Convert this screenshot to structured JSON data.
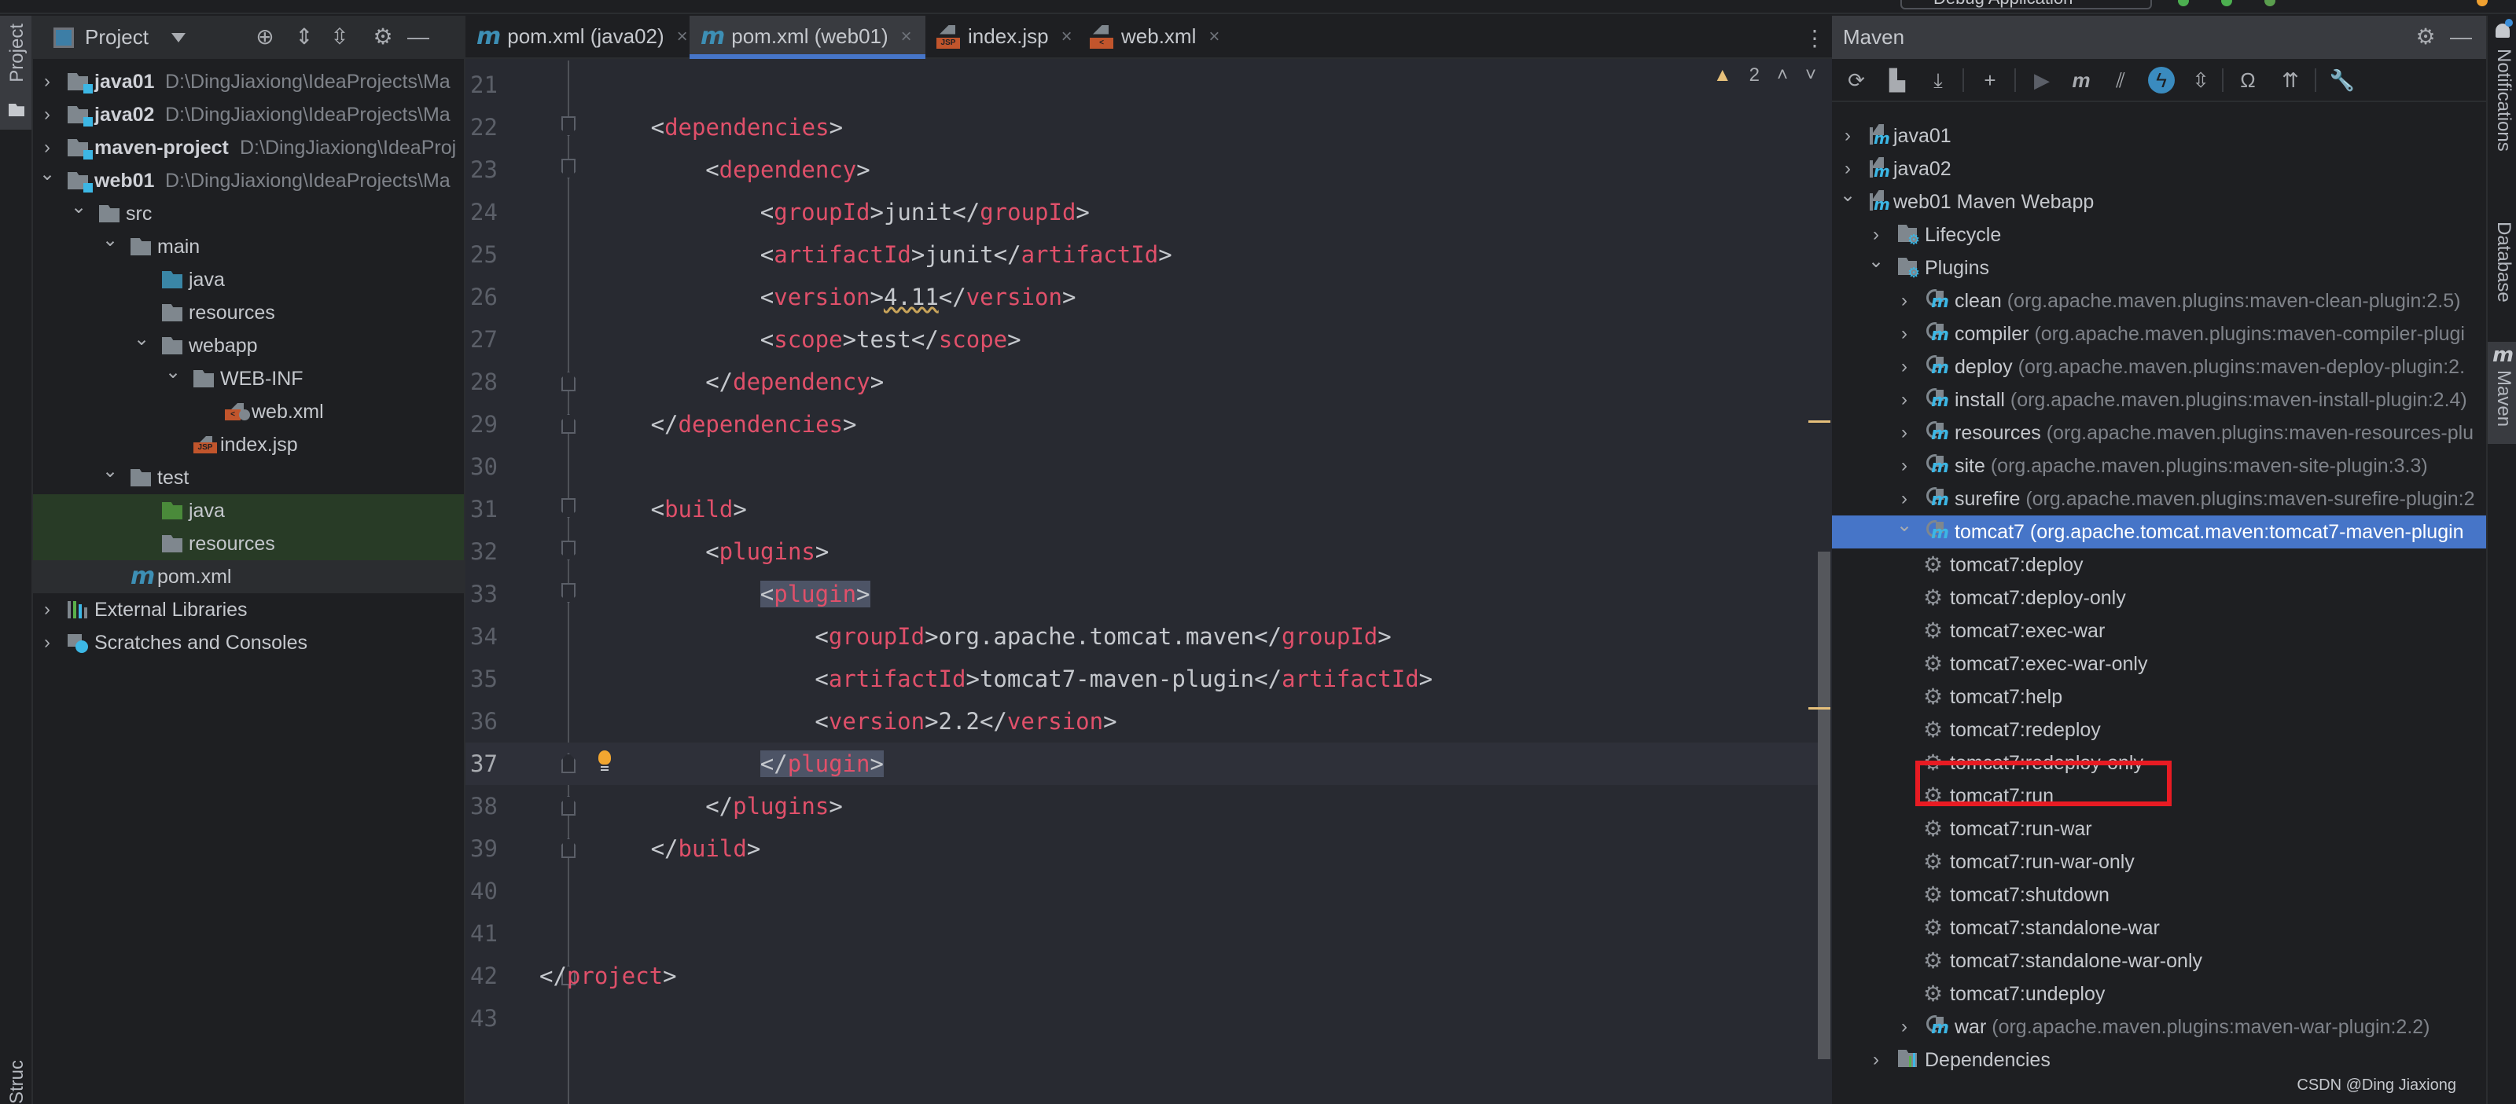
{
  "topbar": {
    "run_config": "Debug Application"
  },
  "left_stripe": {
    "project_tab": "Project",
    "structure_tab": "Structure"
  },
  "project_panel": {
    "title": "Project",
    "toolbar": [
      "locate-icon",
      "expand-all-icon",
      "collapse-all-icon",
      "gear-icon",
      "minimize-icon"
    ],
    "tree": [
      {
        "label": "java01",
        "path": "D:\\DingJiaxiong\\IdeaProjects\\Ma",
        "depth": 0,
        "expanded": false,
        "icon": "module-folder",
        "bold": true
      },
      {
        "label": "java02",
        "path": "D:\\DingJiaxiong\\IdeaProjects\\Ma",
        "depth": 0,
        "expanded": false,
        "icon": "module-folder",
        "bold": true
      },
      {
        "label": "maven-project",
        "path": "D:\\DingJiaxiong\\IdeaProj",
        "depth": 0,
        "expanded": false,
        "icon": "module-folder",
        "bold": true
      },
      {
        "label": "web01",
        "path": "D:\\DingJiaxiong\\IdeaProjects\\Ma",
        "depth": 0,
        "expanded": true,
        "icon": "module-folder",
        "bold": true
      },
      {
        "label": "src",
        "depth": 1,
        "expanded": true,
        "icon": "folder"
      },
      {
        "label": "main",
        "depth": 2,
        "expanded": true,
        "icon": "folder"
      },
      {
        "label": "java",
        "depth": 3,
        "icon": "source-folder"
      },
      {
        "label": "resources",
        "depth": 3,
        "icon": "resources-folder"
      },
      {
        "label": "webapp",
        "depth": 3,
        "expanded": true,
        "icon": "web-folder"
      },
      {
        "label": "WEB-INF",
        "depth": 4,
        "expanded": true,
        "icon": "folder"
      },
      {
        "label": "web.xml",
        "depth": 5,
        "icon": "web-xml-file"
      },
      {
        "label": "index.jsp",
        "depth": 4,
        "icon": "jsp-file"
      },
      {
        "label": "test",
        "depth": 2,
        "expanded": true,
        "icon": "folder"
      },
      {
        "label": "java",
        "depth": 3,
        "icon": "test-source-folder"
      },
      {
        "label": "resources",
        "depth": 3,
        "icon": "test-resources-folder"
      },
      {
        "label": "pom.xml",
        "depth": 2,
        "icon": "maven-file"
      },
      {
        "label": "External Libraries",
        "depth": 0,
        "expanded": false,
        "icon": "libraries"
      },
      {
        "label": "Scratches and Consoles",
        "depth": 0,
        "expanded": false,
        "icon": "scratches"
      }
    ]
  },
  "editor": {
    "tabs": [
      {
        "label": "pom.xml (java02)",
        "icon": "maven-file",
        "active": false
      },
      {
        "label": "pom.xml (web01)",
        "icon": "maven-file",
        "active": true
      },
      {
        "label": "index.jsp",
        "icon": "jsp-file",
        "active": false
      },
      {
        "label": "web.xml",
        "icon": "web-xml-file",
        "active": false
      }
    ],
    "inspection": {
      "warnings": "2"
    },
    "current_line": 37,
    "lines": [
      {
        "n": "21",
        "indent": 0,
        "parts": []
      },
      {
        "n": "22",
        "indent": 1,
        "parts": [
          [
            "b",
            "<"
          ],
          [
            "t",
            "dependencies"
          ],
          [
            "b",
            ">"
          ]
        ],
        "fold": "open"
      },
      {
        "n": "23",
        "indent": 2,
        "parts": [
          [
            "b",
            "<"
          ],
          [
            "t",
            "dependency"
          ],
          [
            "b",
            ">"
          ]
        ],
        "fold": "open"
      },
      {
        "n": "24",
        "indent": 3,
        "parts": [
          [
            "b",
            "<"
          ],
          [
            "t",
            "groupId"
          ],
          [
            "b",
            ">"
          ],
          [
            "x",
            "junit"
          ],
          [
            "b",
            "</"
          ],
          [
            "t",
            "groupId"
          ],
          [
            "b",
            ">"
          ]
        ]
      },
      {
        "n": "25",
        "indent": 3,
        "parts": [
          [
            "b",
            "<"
          ],
          [
            "t",
            "artifactId"
          ],
          [
            "b",
            ">"
          ],
          [
            "x",
            "junit"
          ],
          [
            "b",
            "</"
          ],
          [
            "t",
            "artifactId"
          ],
          [
            "b",
            ">"
          ]
        ]
      },
      {
        "n": "26",
        "indent": 3,
        "parts": [
          [
            "b",
            "<"
          ],
          [
            "t",
            "version"
          ],
          [
            "b",
            ">"
          ],
          [
            "w",
            "4.11"
          ],
          [
            "b",
            "</"
          ],
          [
            "t",
            "version"
          ],
          [
            "b",
            ">"
          ]
        ]
      },
      {
        "n": "27",
        "indent": 3,
        "parts": [
          [
            "b",
            "<"
          ],
          [
            "t",
            "scope"
          ],
          [
            "b",
            ">"
          ],
          [
            "x",
            "test"
          ],
          [
            "b",
            "</"
          ],
          [
            "t",
            "scope"
          ],
          [
            "b",
            ">"
          ]
        ]
      },
      {
        "n": "28",
        "indent": 2,
        "parts": [
          [
            "b",
            "</"
          ],
          [
            "t",
            "dependency"
          ],
          [
            "b",
            ">"
          ]
        ],
        "fold": "close"
      },
      {
        "n": "29",
        "indent": 1,
        "parts": [
          [
            "b",
            "</"
          ],
          [
            "t",
            "dependencies"
          ],
          [
            "b",
            ">"
          ]
        ],
        "fold": "close"
      },
      {
        "n": "30",
        "indent": 0,
        "parts": []
      },
      {
        "n": "31",
        "indent": 1,
        "parts": [
          [
            "b",
            "<"
          ],
          [
            "t",
            "build"
          ],
          [
            "b",
            ">"
          ]
        ],
        "fold": "open"
      },
      {
        "n": "32",
        "indent": 2,
        "parts": [
          [
            "b",
            "<"
          ],
          [
            "t",
            "plugins"
          ],
          [
            "b",
            ">"
          ]
        ],
        "fold": "open"
      },
      {
        "n": "33",
        "indent": 3,
        "parts": [
          [
            "hb",
            "<"
          ],
          [
            "ht",
            "plugin"
          ],
          [
            "hb",
            ">"
          ]
        ],
        "fold": "open"
      },
      {
        "n": "34",
        "indent": 4,
        "parts": [
          [
            "b",
            "<"
          ],
          [
            "t",
            "groupId"
          ],
          [
            "b",
            ">"
          ],
          [
            "x",
            "org.apache.tomcat.maven"
          ],
          [
            "b",
            "</"
          ],
          [
            "t",
            "groupId"
          ],
          [
            "b",
            ">"
          ]
        ]
      },
      {
        "n": "35",
        "indent": 4,
        "parts": [
          [
            "b",
            "<"
          ],
          [
            "t",
            "artifactId"
          ],
          [
            "b",
            ">"
          ],
          [
            "x",
            "tomcat7-maven-plugin"
          ],
          [
            "b",
            "</"
          ],
          [
            "t",
            "artifactId"
          ],
          [
            "b",
            ">"
          ]
        ]
      },
      {
        "n": "36",
        "indent": 4,
        "parts": [
          [
            "b",
            "<"
          ],
          [
            "t",
            "version"
          ],
          [
            "b",
            ">"
          ],
          [
            "x",
            "2.2"
          ],
          [
            "b",
            "</"
          ],
          [
            "t",
            "version"
          ],
          [
            "b",
            ">"
          ]
        ]
      },
      {
        "n": "37",
        "indent": 3,
        "parts": [
          [
            "hb",
            "</"
          ],
          [
            "ht",
            "plugin"
          ],
          [
            "hb",
            ">"
          ]
        ],
        "fold": "close",
        "bulb": true
      },
      {
        "n": "38",
        "indent": 2,
        "parts": [
          [
            "b",
            "</"
          ],
          [
            "t",
            "plugins"
          ],
          [
            "b",
            ">"
          ]
        ],
        "fold": "close"
      },
      {
        "n": "39",
        "indent": 1,
        "parts": [
          [
            "b",
            "</"
          ],
          [
            "t",
            "build"
          ],
          [
            "b",
            ">"
          ]
        ],
        "fold": "close"
      },
      {
        "n": "40",
        "indent": 0,
        "parts": []
      },
      {
        "n": "41",
        "indent": 0,
        "parts": []
      },
      {
        "n": "42",
        "indent": 0,
        "parts": [
          [
            "b",
            "</"
          ],
          [
            "t",
            "project"
          ],
          [
            "b",
            ">"
          ]
        ],
        "fold": "close"
      },
      {
        "n": "43",
        "indent": 0,
        "parts": []
      }
    ]
  },
  "maven_panel": {
    "title": "Maven",
    "toolbar": [
      "reload-icon",
      "generate-sources-icon",
      "download-icon",
      "add-icon",
      "run-icon",
      "execute-goal-icon",
      "skip-tests-icon",
      "offline-icon",
      "collapse-icon",
      "analyze-dependencies-icon",
      "show-diagram-icon",
      "settings-wrench-icon"
    ],
    "tree": [
      {
        "label": "java01",
        "depth": 0,
        "expanded": false,
        "icon": "maven-project"
      },
      {
        "label": "java02",
        "depth": 0,
        "expanded": false,
        "icon": "maven-project"
      },
      {
        "label": "web01 Maven Webapp",
        "depth": 0,
        "expanded": true,
        "icon": "maven-project"
      },
      {
        "label": "Lifecycle",
        "depth": 1,
        "expanded": false,
        "icon": "config-folder"
      },
      {
        "label": "Plugins",
        "depth": 1,
        "expanded": true,
        "icon": "config-folder"
      },
      {
        "label": "clean",
        "sub": "(org.apache.maven.plugins:maven-clean-plugin:2.5)",
        "depth": 2,
        "expanded": false,
        "icon": "plugin"
      },
      {
        "label": "compiler",
        "sub": "(org.apache.maven.plugins:maven-compiler-plugi",
        "depth": 2,
        "expanded": false,
        "icon": "plugin"
      },
      {
        "label": "deploy",
        "sub": "(org.apache.maven.plugins:maven-deploy-plugin:2.",
        "depth": 2,
        "expanded": false,
        "icon": "plugin"
      },
      {
        "label": "install",
        "sub": "(org.apache.maven.plugins:maven-install-plugin:2.4)",
        "depth": 2,
        "expanded": false,
        "icon": "plugin"
      },
      {
        "label": "resources",
        "sub": "(org.apache.maven.plugins:maven-resources-plu",
        "depth": 2,
        "expanded": false,
        "icon": "plugin"
      },
      {
        "label": "site",
        "sub": "(org.apache.maven.plugins:maven-site-plugin:3.3)",
        "depth": 2,
        "expanded": false,
        "icon": "plugin"
      },
      {
        "label": "surefire",
        "sub": "(org.apache.maven.plugins:maven-surefire-plugin:2",
        "depth": 2,
        "expanded": false,
        "icon": "plugin"
      },
      {
        "label": "tomcat7",
        "sub": "(org.apache.tomcat.maven:tomcat7-maven-plugin",
        "depth": 2,
        "expanded": true,
        "icon": "plugin",
        "selected": true
      },
      {
        "label": "tomcat7:deploy",
        "depth": 3,
        "icon": "goal"
      },
      {
        "label": "tomcat7:deploy-only",
        "depth": 3,
        "icon": "goal"
      },
      {
        "label": "tomcat7:exec-war",
        "depth": 3,
        "icon": "goal"
      },
      {
        "label": "tomcat7:exec-war-only",
        "depth": 3,
        "icon": "goal"
      },
      {
        "label": "tomcat7:help",
        "depth": 3,
        "icon": "goal"
      },
      {
        "label": "tomcat7:redeploy",
        "depth": 3,
        "icon": "goal"
      },
      {
        "label": "tomcat7:redeploy-only",
        "depth": 3,
        "icon": "goal"
      },
      {
        "label": "tomcat7:run",
        "depth": 3,
        "icon": "goal",
        "highlighted": true
      },
      {
        "label": "tomcat7:run-war",
        "depth": 3,
        "icon": "goal"
      },
      {
        "label": "tomcat7:run-war-only",
        "depth": 3,
        "icon": "goal"
      },
      {
        "label": "tomcat7:shutdown",
        "depth": 3,
        "icon": "goal"
      },
      {
        "label": "tomcat7:standalone-war",
        "depth": 3,
        "icon": "goal"
      },
      {
        "label": "tomcat7:standalone-war-only",
        "depth": 3,
        "icon": "goal"
      },
      {
        "label": "tomcat7:undeploy",
        "depth": 3,
        "icon": "goal"
      },
      {
        "label": "war",
        "sub": "(org.apache.maven.plugins:maven-war-plugin:2.2)",
        "depth": 2,
        "expanded": false,
        "icon": "plugin"
      },
      {
        "label": "Dependencies",
        "depth": 1,
        "expanded": false,
        "icon": "dependencies"
      }
    ]
  },
  "right_stripe": {
    "tabs": [
      "Notifications",
      "Database",
      "Maven"
    ]
  },
  "watermark": "CSDN @Ding Jiaxiong",
  "colors": {
    "accent": "#4675c8",
    "tag": "#e0506a",
    "highlight_box": "#e81b23",
    "warning": "#e6c07b"
  }
}
